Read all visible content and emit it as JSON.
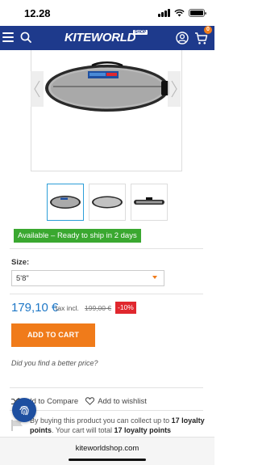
{
  "status_bar": {
    "time": "12.28"
  },
  "header": {
    "logo_text": "KITEWORLD",
    "logo_badge": "SHOP",
    "cart_count": "0",
    "brand_color": "#1e3a8c",
    "icons": [
      "menu-icon",
      "search-icon",
      "user-icon",
      "cart-icon"
    ]
  },
  "product": {
    "availability": "Available – Ready to ship in 2 days",
    "availability_color": "#3aa830",
    "size_label": "Size:",
    "size_selected": "5'8\"",
    "price": "179,10 €",
    "tax_label": "tax incl.",
    "old_price": "199,00 €",
    "discount": "-10%",
    "add_to_cart_label": "ADD TO CART",
    "accent_color": "#f07b1a",
    "better_price_text": "Did you find a better price?",
    "compare_label": "Add to Compare",
    "wishlist_label": "Add to wishlist"
  },
  "loyalty": {
    "text_1": "By buying this product you can collect up to ",
    "points": "17 loyalty points",
    "text_2": ". Your cart will total ",
    "points_2": "17 loyalty points"
  },
  "browser": {
    "url": "kiteworldshop.com"
  }
}
